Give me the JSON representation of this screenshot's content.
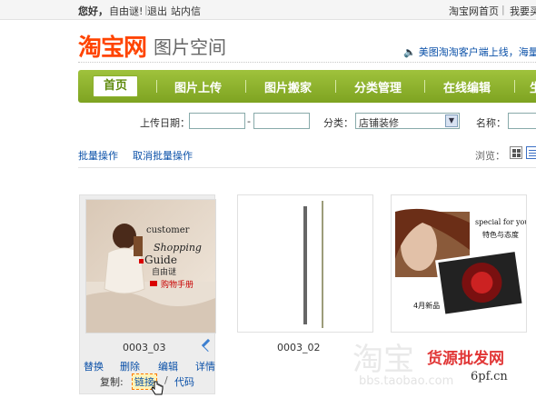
{
  "topbar": {
    "greeting": "您好，",
    "username": "自由谜!",
    "logout": "退出",
    "messages": "站内信",
    "taobao_home": "淘宝网首页",
    "want_buy": "我要买"
  },
  "header": {
    "brand": "淘宝网",
    "product": "图片空间",
    "notice": "美图淘淘客户端上线，海量免"
  },
  "nav": {
    "items": [
      "首页",
      "图片上传",
      "图片搬家",
      "分类管理",
      "在线编辑",
      "生"
    ]
  },
  "filter": {
    "upload_date_label": "上传日期：",
    "date_sep": "-",
    "category_label": "分类：",
    "category_value": "店铺装修",
    "name_label": "名称："
  },
  "actions": {
    "batch": "批量操作",
    "cancel_batch": "取消批量操作",
    "browse_label": "浏览："
  },
  "images": [
    {
      "filename": "0003_03",
      "ops": {
        "replace": "替换",
        "delete": "删除",
        "edit": "编辑",
        "detail": "详情"
      },
      "copy_label": "复制:",
      "copy_link": "链接",
      "copy_sep": "/",
      "copy_code": "代码",
      "art": {
        "line1": "customer",
        "line2": "Shopping",
        "line3": "Guide",
        "line4": "自由谜",
        "line5": "购物手册"
      }
    },
    {
      "filename": "0003_02"
    },
    {
      "filename": "",
      "art": {
        "line1": "special for you",
        "line2": "特色与态度",
        "line3": "4月新品"
      }
    }
  ],
  "watermark": {
    "text": "淘宝",
    "url": "bbs.taobao.com",
    "red": "货源批发网",
    "red_url": "6pf.cn"
  }
}
